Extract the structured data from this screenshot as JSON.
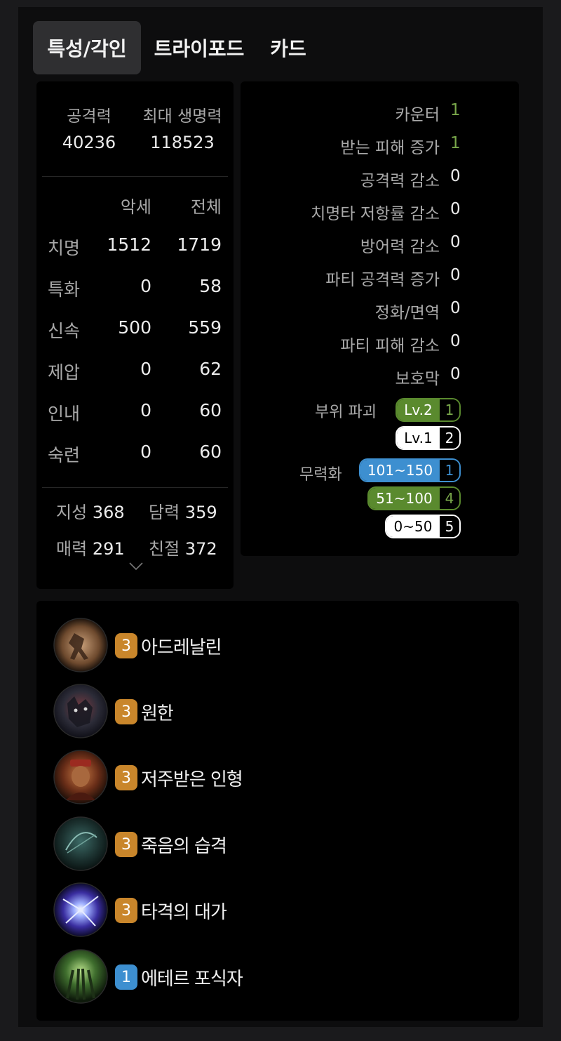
{
  "tabs": [
    {
      "label": "특성/각인"
    },
    {
      "label": "트라이포드"
    },
    {
      "label": "카드"
    }
  ],
  "stats": {
    "attack_label": "공격력",
    "attack_value": "40236",
    "hp_label": "최대 생명력",
    "hp_value": "118523",
    "col_accessory": "악세",
    "col_total": "전체",
    "rows": [
      {
        "name": "치명",
        "accessory": "1512",
        "total": "1719"
      },
      {
        "name": "특화",
        "accessory": "0",
        "total": "58"
      },
      {
        "name": "신속",
        "accessory": "500",
        "total": "559"
      },
      {
        "name": "제압",
        "accessory": "0",
        "total": "62"
      },
      {
        "name": "인내",
        "accessory": "0",
        "total": "60"
      },
      {
        "name": "숙련",
        "accessory": "0",
        "total": "60"
      }
    ],
    "attributes": [
      {
        "name": "지성",
        "value": "368"
      },
      {
        "name": "담력",
        "value": "359"
      },
      {
        "name": "매력",
        "value": "291"
      },
      {
        "name": "친절",
        "value": "372"
      }
    ]
  },
  "effects": {
    "rows": [
      {
        "name": "카운터",
        "value": "1",
        "color": "#79a74a"
      },
      {
        "name": "받는 피해 증가",
        "value": "1",
        "color": "#79a74a"
      },
      {
        "name": "공격력 감소",
        "value": "0"
      },
      {
        "name": "치명타 저항률 감소",
        "value": "0"
      },
      {
        "name": "방어력 감소",
        "value": "0"
      },
      {
        "name": "파티 공격력 증가",
        "value": "0"
      },
      {
        "name": "정화/면역",
        "value": "0"
      },
      {
        "name": "파티 피해 감소",
        "value": "0"
      },
      {
        "name": "보호막",
        "value": "0"
      }
    ],
    "destruction": {
      "label": "부위 파괴",
      "badges": [
        {
          "level": "Lv.2",
          "count": "1",
          "color": "#5a8a2e"
        },
        {
          "level": "Lv.1",
          "count": "2",
          "color": "#ffffff"
        }
      ]
    },
    "neutralize": {
      "label": "무력화",
      "badges": [
        {
          "level": "101~150",
          "count": "1",
          "color": "#3d8fd0"
        },
        {
          "level": "51~100",
          "count": "4",
          "color": "#5a8a2e"
        },
        {
          "level": "0~50",
          "count": "5",
          "color": "#ffffff"
        }
      ]
    }
  },
  "engravings": [
    {
      "level": "3",
      "name": "아드레날린",
      "level_color": "#c9862b",
      "icon": "adrenaline-icon"
    },
    {
      "level": "3",
      "name": "원한",
      "level_color": "#c9862b",
      "icon": "grudge-icon"
    },
    {
      "level": "3",
      "name": "저주받은 인형",
      "level_color": "#c9862b",
      "icon": "cursed-doll-icon"
    },
    {
      "level": "3",
      "name": "죽음의 습격",
      "level_color": "#c9862b",
      "icon": "death-strike-icon"
    },
    {
      "level": "3",
      "name": "타격의 대가",
      "level_color": "#c9862b",
      "icon": "hit-master-icon"
    },
    {
      "level": "1",
      "name": "에테르 포식자",
      "level_color": "#3d8fd0",
      "icon": "ether-predator-icon"
    }
  ]
}
